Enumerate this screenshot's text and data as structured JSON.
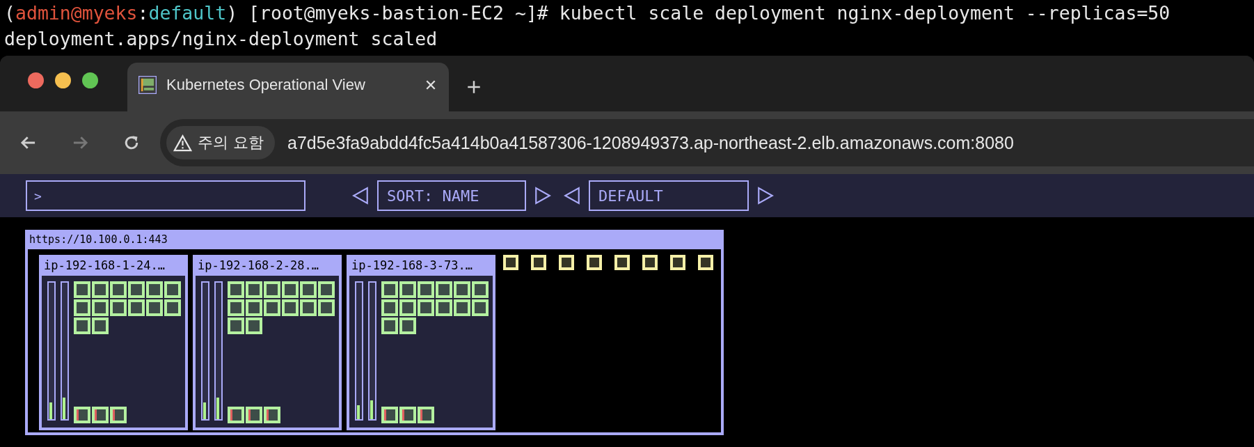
{
  "terminal": {
    "lines": [
      {
        "segments": [
          {
            "text": "(",
            "color": "#e8e8e8"
          },
          {
            "text": "admin@myeks",
            "color": "#e0533c"
          },
          {
            "text": ":",
            "color": "#e8e8e8"
          },
          {
            "text": "default",
            "color": "#4fc6c9"
          },
          {
            "text": ") [root@myeks-bastion-EC2 ~]# kubectl scale deployment nginx-deployment --replicas=50",
            "color": "#e8e8e8"
          }
        ]
      },
      {
        "segments": [
          {
            "text": "deployment.apps/nginx-deployment scaled",
            "color": "#e8e8e8"
          }
        ]
      }
    ]
  },
  "browser": {
    "tab": {
      "title": "Kubernetes Operational View",
      "selected": true
    },
    "security_chip": "주의 요함",
    "url": "a7d5e3fa9abdd4fc5a414b0a41587306-1208949373.ap-northeast-2.elb.amazonaws.com:8080",
    "forward_disabled": true
  },
  "app": {
    "filter": {
      "value": ">"
    },
    "sort": {
      "label": "SORT: NAME"
    },
    "namespace": {
      "label": "DEFAULT"
    },
    "cluster": {
      "title": "https://10.100.0.1:443",
      "nodes": [
        {
          "name": "ip-192-168-1-24.…",
          "meters": [
            {
              "level": 0.12
            },
            {
              "level": 0.16
            }
          ],
          "pods": [
            {
              "kind": "app"
            },
            {
              "kind": "app"
            },
            {
              "kind": "app"
            },
            {
              "kind": "app"
            },
            {
              "kind": "app"
            },
            {
              "kind": "app"
            },
            {
              "kind": "app"
            },
            {
              "kind": "app"
            },
            {
              "kind": "app"
            },
            {
              "kind": "app"
            },
            {
              "kind": "app"
            },
            {
              "kind": "app"
            },
            {
              "kind": "app"
            },
            {
              "kind": "app"
            }
          ],
          "system_pods": [
            {
              "kind": "system"
            },
            {
              "kind": "system"
            },
            {
              "kind": "system"
            }
          ]
        },
        {
          "name": "ip-192-168-2-28.…",
          "meters": [
            {
              "level": 0.12
            },
            {
              "level": 0.16
            }
          ],
          "pods": [
            {
              "kind": "app"
            },
            {
              "kind": "app"
            },
            {
              "kind": "app"
            },
            {
              "kind": "app"
            },
            {
              "kind": "app"
            },
            {
              "kind": "app"
            },
            {
              "kind": "app"
            },
            {
              "kind": "app"
            },
            {
              "kind": "app"
            },
            {
              "kind": "app"
            },
            {
              "kind": "app"
            },
            {
              "kind": "app"
            },
            {
              "kind": "app"
            },
            {
              "kind": "app"
            }
          ],
          "system_pods": [
            {
              "kind": "system"
            },
            {
              "kind": "system"
            },
            {
              "kind": "system"
            }
          ]
        },
        {
          "name": "ip-192-168-3-73.…",
          "meters": [
            {
              "level": 0.1
            },
            {
              "level": 0.14
            }
          ],
          "pods": [
            {
              "kind": "app"
            },
            {
              "kind": "app"
            },
            {
              "kind": "app"
            },
            {
              "kind": "app"
            },
            {
              "kind": "app"
            },
            {
              "kind": "app"
            },
            {
              "kind": "app"
            },
            {
              "kind": "app"
            },
            {
              "kind": "app"
            },
            {
              "kind": "app"
            },
            {
              "kind": "app"
            },
            {
              "kind": "app"
            },
            {
              "kind": "app"
            },
            {
              "kind": "app"
            }
          ],
          "system_pods": [
            {
              "kind": "system"
            },
            {
              "kind": "system"
            },
            {
              "kind": "system"
            }
          ]
        }
      ],
      "unassigned_pods": [
        {
          "kind": "pending"
        },
        {
          "kind": "pending"
        },
        {
          "kind": "pending"
        },
        {
          "kind": "pending"
        },
        {
          "kind": "pending"
        },
        {
          "kind": "pending"
        },
        {
          "kind": "pending"
        },
        {
          "kind": "pending"
        }
      ]
    }
  }
}
